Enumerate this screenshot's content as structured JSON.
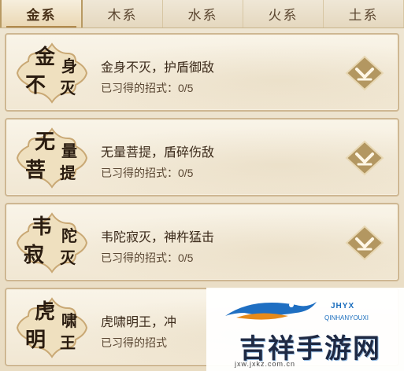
{
  "tabs": [
    {
      "label": "金系",
      "active": true
    },
    {
      "label": "木系",
      "active": false
    },
    {
      "label": "水系",
      "active": false
    },
    {
      "label": "火系",
      "active": false
    },
    {
      "label": "土系",
      "active": false
    }
  ],
  "skills": [
    {
      "badge_chars": [
        "金",
        "身",
        "不",
        "灭"
      ],
      "title": "金身不灭，护盾御敌",
      "progress": "已习得的招式：0/5"
    },
    {
      "badge_chars": [
        "无",
        "量",
        "菩",
        "提"
      ],
      "title": "无量菩提，盾碎伤敌",
      "progress": "已习得的招式：0/5"
    },
    {
      "badge_chars": [
        "韦",
        "陀",
        "寂",
        "灭"
      ],
      "title": "韦陀寂灭，神杵猛击",
      "progress": "已习得的招式：0/5"
    },
    {
      "badge_chars": [
        "虎",
        "啸",
        "明",
        "王"
      ],
      "title": "虎啸明王，冲",
      "progress": "已习得的招式"
    }
  ],
  "icons": {
    "expand": "chevron-down-icon"
  },
  "colors": {
    "accent": "#c2a676",
    "text": "#3b2a1a",
    "button": "#b39761"
  },
  "watermark": {
    "brand": "JHYX",
    "brand_sub": "QINHANYOUXI",
    "title": "吉祥手游网",
    "url": "jxw.jxkz.com.cn"
  }
}
